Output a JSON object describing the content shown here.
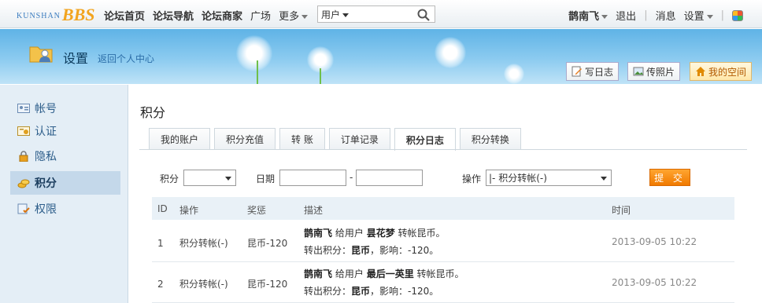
{
  "topbar": {
    "logo_small": "KUNSHAN",
    "logo_big": "BBS",
    "nav": [
      "论坛首页",
      "论坛导航",
      "论坛商家",
      "广场",
      "更多"
    ],
    "search_scope": "用户",
    "user_name": "鹊南飞",
    "logout": "退出",
    "messages": "消息",
    "settings": "设置"
  },
  "header": {
    "title": "设置",
    "back_link": "返回个人中心",
    "buttons": [
      "写日志",
      "传照片",
      "我的空间"
    ]
  },
  "sidebar": {
    "items": [
      {
        "label": "帐号",
        "icon": "id-card-icon"
      },
      {
        "label": "认证",
        "icon": "certificate-icon"
      },
      {
        "label": "隐私",
        "icon": "lock-icon"
      },
      {
        "label": "积分",
        "icon": "coins-icon",
        "active": true
      },
      {
        "label": "权限",
        "icon": "permission-icon"
      }
    ]
  },
  "main": {
    "title": "积分",
    "tabs": [
      "我的账户",
      "积分充值",
      "转 账",
      "订单记录",
      "积分日志",
      "积分转换"
    ],
    "active_tab": "积分日志",
    "filters": {
      "credit_label": "积分",
      "credit_value": "",
      "date_label": "日期",
      "date_sep": "-",
      "op_label": "操作",
      "op_value": "|- 积分转帐(-)",
      "submit": "提 交"
    },
    "table": {
      "headers": [
        "ID",
        "操作",
        "奖惩",
        "描述",
        "时间"
      ],
      "rows": [
        {
          "id": "1",
          "op": "积分转帐(-)",
          "reward": "昆币-120",
          "line1_user": "鹊南飞",
          "line1_mid": "给用户",
          "line1_target": "昙花梦",
          "line1_end": "转帐昆币。",
          "line2_pre": "转出积分：",
          "line2_bold": "昆币",
          "line2_post": "，影响：-120。",
          "time": "2013-09-05 10:22"
        },
        {
          "id": "2",
          "op": "积分转帐(-)",
          "reward": "昆币-120",
          "line1_user": "鹊南飞",
          "line1_mid": "给用户",
          "line1_target": "最后一英里",
          "line1_end": "转帐昆币。",
          "line2_pre": "转出积分：",
          "line2_bold": "昆币",
          "line2_post": "，影响：-120。",
          "time": "2013-09-05 10:22"
        }
      ]
    }
  }
}
